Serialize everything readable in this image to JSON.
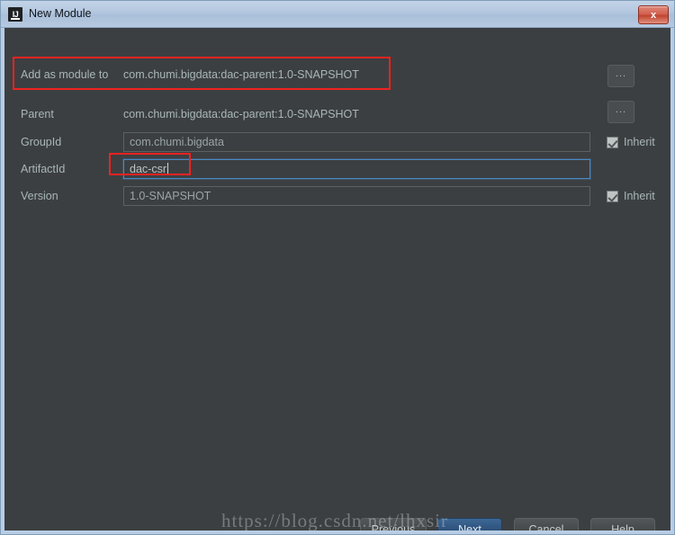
{
  "window": {
    "title": "New Module",
    "icon": "intellij-idea-icon",
    "close_label": "x",
    "frame_color": "#b8cde4",
    "panel_color": "#3c3f41",
    "accent_color": "#4a88c7",
    "annotation_color": "#ee2222"
  },
  "form": {
    "rows": [
      {
        "label": "Add as module to",
        "value": "com.chumi.bigdata:dac-parent:1.0-SNAPSHOT",
        "browse_label": "...",
        "annotated": true
      },
      {
        "label": "Parent",
        "value": "com.chumi.bigdata:dac-parent:1.0-SNAPSHOT",
        "browse_label": "..."
      },
      {
        "label": "GroupId",
        "value": "com.chumi.bigdata",
        "inherit_label": "Inherit",
        "inherit_checked": true
      },
      {
        "label": "ArtifactId",
        "value": "dac-csr",
        "focused": true,
        "annotated": true
      },
      {
        "label": "Version",
        "value": "1.0-SNAPSHOT",
        "inherit_label": "Inherit",
        "inherit_checked": true
      }
    ]
  },
  "footer": {
    "previous": {
      "prefix": "",
      "mnemonic": "P",
      "suffix": "revious"
    },
    "next": {
      "prefix": "",
      "mnemonic": "N",
      "suffix": "ext"
    },
    "cancel": {
      "prefix": "Cancel",
      "mnemonic": "",
      "suffix": ""
    },
    "help": {
      "prefix": "Help",
      "mnemonic": "",
      "suffix": ""
    }
  },
  "watermark": {
    "text": "https://blog.csdn.net/lhxsir"
  }
}
